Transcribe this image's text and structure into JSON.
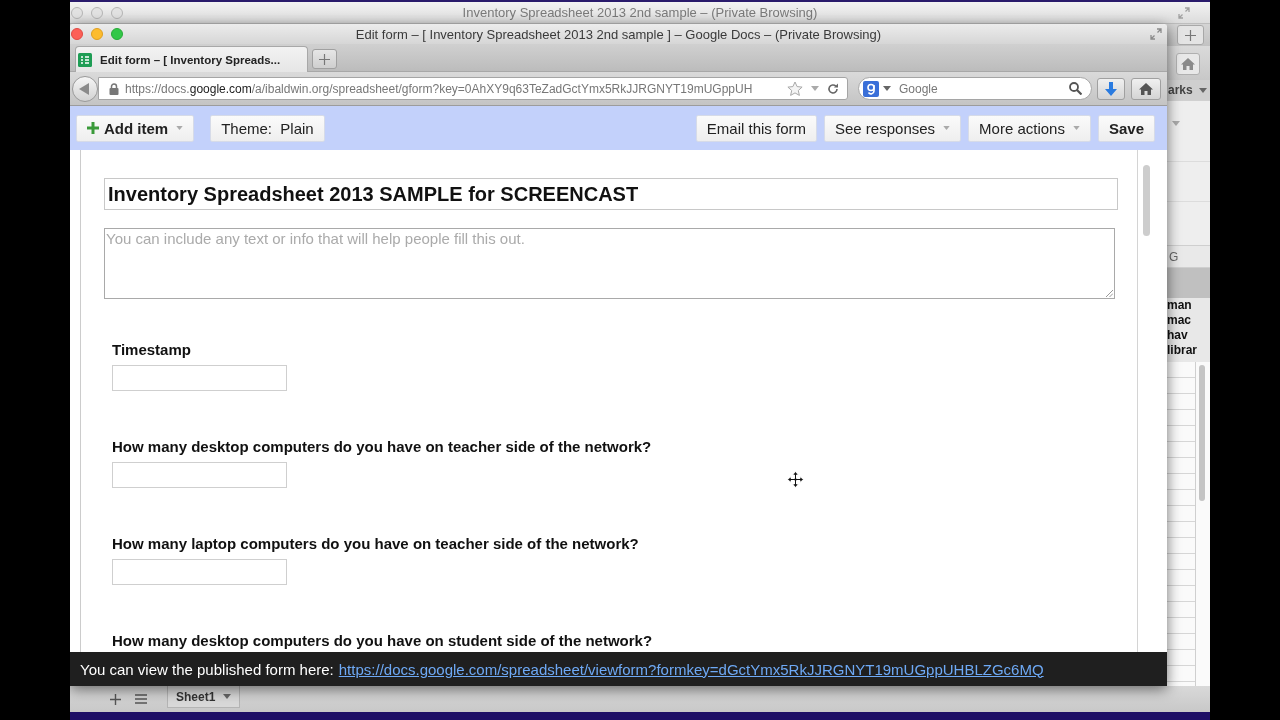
{
  "background_window": {
    "title": "Inventory Spreadsheet 2013 2nd sample – (Private Browsing)",
    "bookmarks_label": "arks",
    "column_header": "G",
    "cell_lines": [
      "man",
      "mac",
      "hav",
      "librar"
    ],
    "sheet_tabs": [
      {
        "label": "Sheet1",
        "selected": true
      }
    ]
  },
  "window": {
    "title": "Edit form – [ Inventory Spreadsheet 2013 2nd sample ] – Google Docs – (Private Browsing)"
  },
  "tabs": [
    {
      "label": "Edit form – [ Inventory Spreads...",
      "selected": true
    }
  ],
  "address_bar": {
    "url": "https://docs.**google.com**/a/ibaldwin.org/spreadsheet/gform?key=0AhXY9q63TeZadGctYmx5RkJJRGNYT19mUGppUH"
  },
  "search": {
    "placeholder": "Google"
  },
  "toolbar": {
    "left": [
      {
        "label": "Add item",
        "kind": "add"
      },
      {
        "label": "Theme:  Plain",
        "kind": "plain"
      }
    ],
    "right": [
      {
        "label": "Email this form",
        "kind": "plain"
      },
      {
        "label": "See responses",
        "kind": "menu"
      },
      {
        "label": "More actions",
        "kind": "menu"
      },
      {
        "label": "Save",
        "kind": "primary"
      }
    ]
  },
  "form": {
    "title": "Inventory Spreadsheet 2013 SAMPLE for SCREENCAST",
    "description_placeholder": "You can include any text or info that will help people fill this out.",
    "questions": [
      {
        "label": "Timestamp"
      },
      {
        "label": "How many desktop computers do you have on teacher side of the network?"
      },
      {
        "label": "How many laptop computers do you have on teacher side of the network?"
      }
    ],
    "partly_hidden_question": {
      "label": "How many desktop computers do you have on student side of the network?"
    }
  },
  "notice": {
    "text": "You can view the published form here:",
    "link": "https://docs.google.com/spreadsheet/viewform?formkey=dGctYmx5RkJJRGNYT19mUGppUHBLZGc6MQ"
  }
}
